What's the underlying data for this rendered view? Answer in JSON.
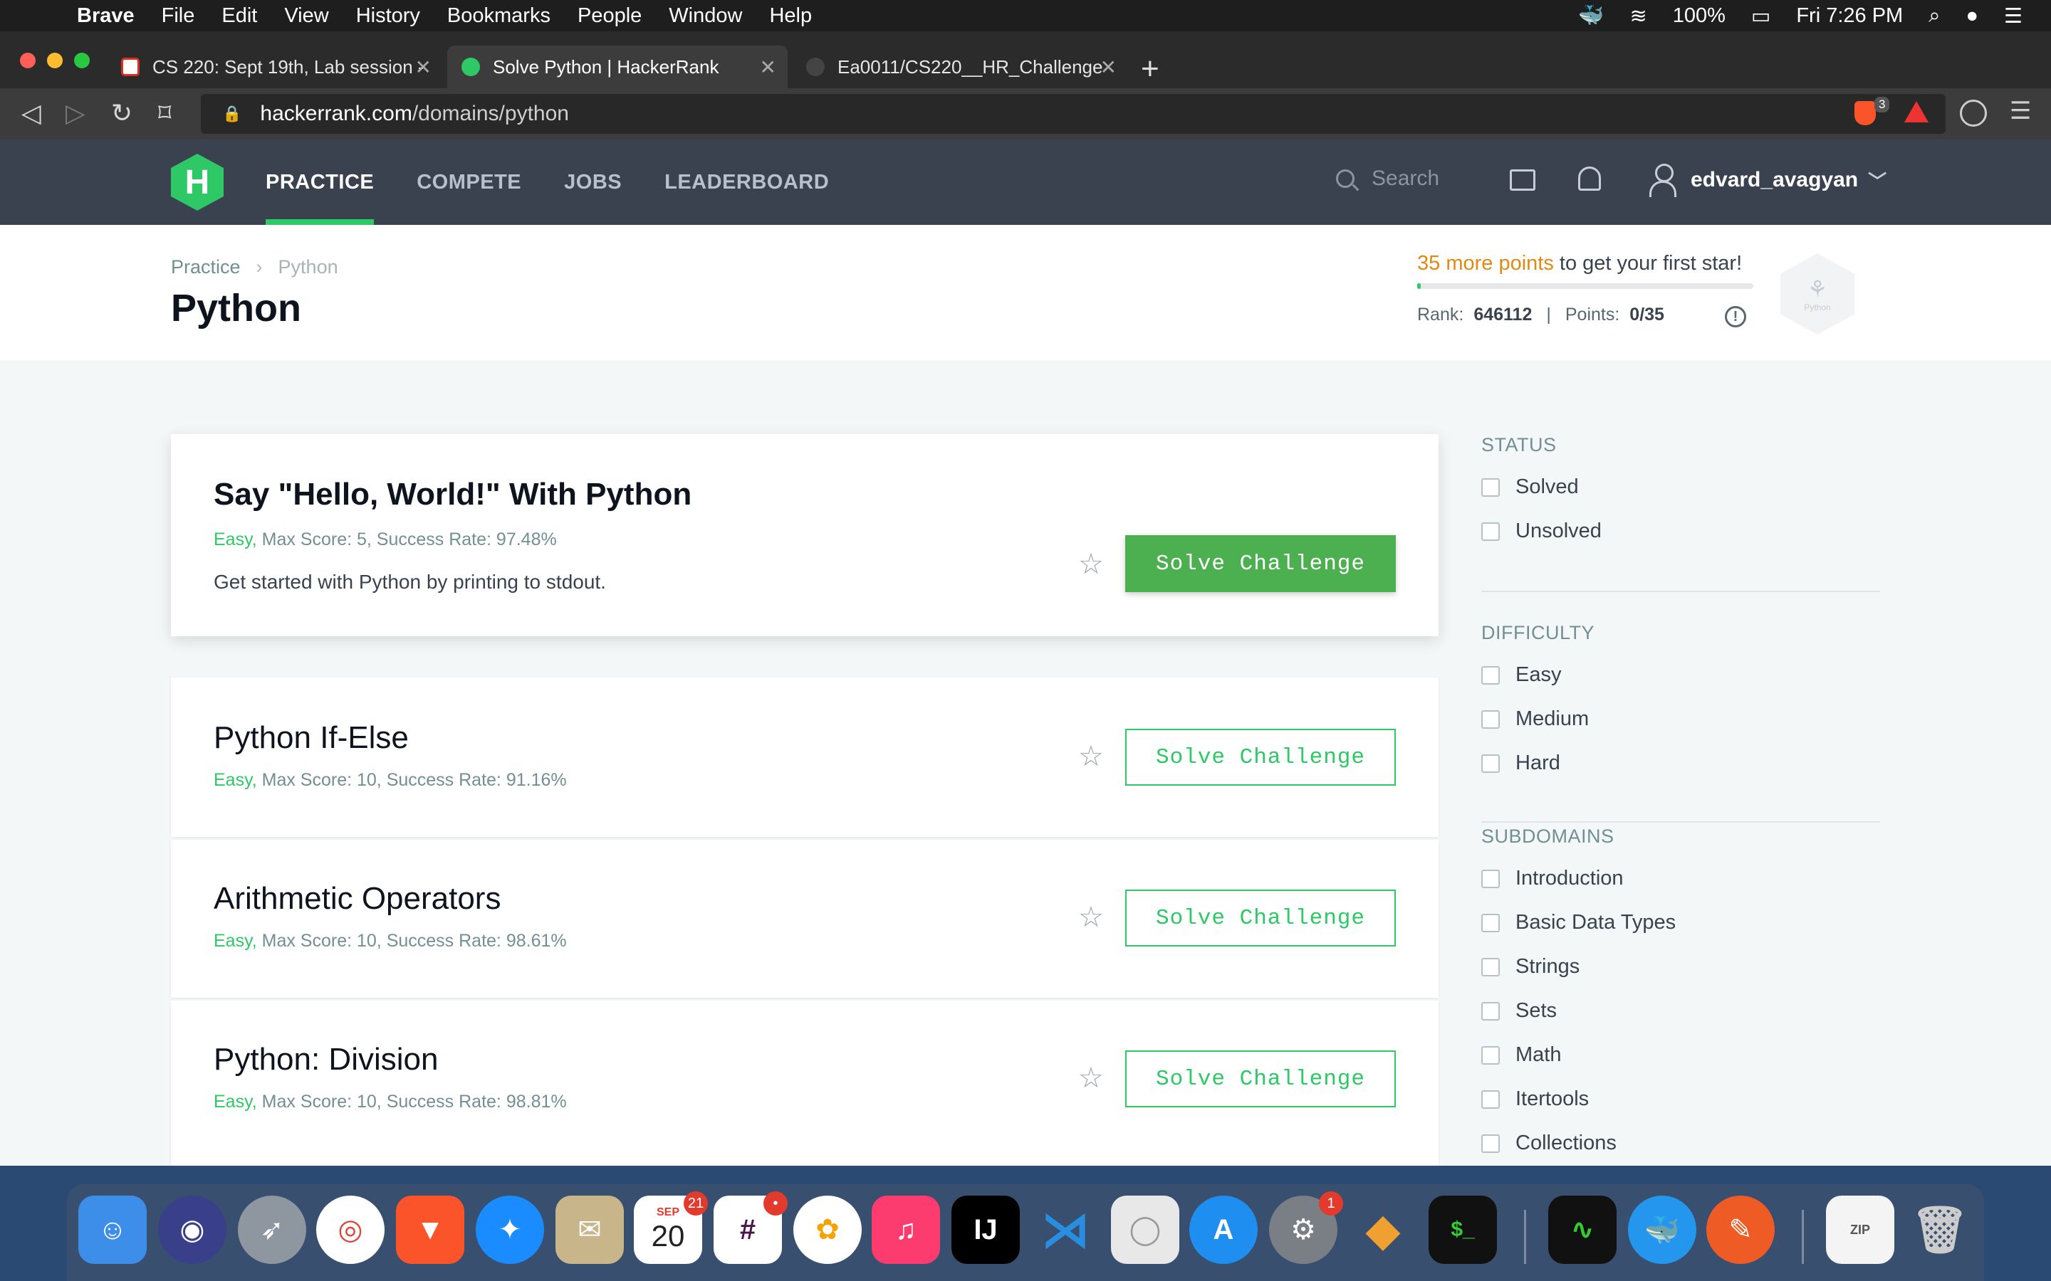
{
  "menubar": {
    "app": "Brave",
    "items": [
      "File",
      "Edit",
      "View",
      "History",
      "Bookmarks",
      "People",
      "Window",
      "Help"
    ],
    "battery": "100%",
    "clock": "Fri 7:26 PM"
  },
  "tabs": [
    {
      "title": "CS 220: Sept 19th, Lab session -",
      "icon": "gmail-icon"
    },
    {
      "title": "Solve Python | HackerRank",
      "icon": "hackerrank-icon"
    },
    {
      "title": "Ea0011/CS220__HR_Challenge",
      "icon": "github-icon"
    }
  ],
  "address": {
    "host": "hackerrank.com",
    "path": "/domains/python",
    "brave_count": "3"
  },
  "hr": {
    "logo": "H",
    "nav": [
      "PRACTICE",
      "COMPETE",
      "JOBS",
      "LEADERBOARD"
    ],
    "search_placeholder": "Search",
    "username": "edvard_avagyan"
  },
  "page": {
    "breadcrumb": [
      "Practice",
      "Python"
    ],
    "title": "Python",
    "points_highlight": "35 more points",
    "points_rest": " to get your first star!",
    "progress_fraction": 0.0,
    "rank_label": "Rank:",
    "rank_value": "646112",
    "points_label": "Points:",
    "points_value": "0/35",
    "badge_label": "Python"
  },
  "challenges": [
    {
      "title": "Say \"Hello, World!\" With Python",
      "difficulty": "Easy,",
      "meta": " Max Score: 5, Success Rate: 97.48%",
      "description": "Get started with Python by printing to stdout.",
      "button": "Solve Challenge"
    },
    {
      "title": "Python If-Else",
      "difficulty": "Easy,",
      "meta": " Max Score: 10, Success Rate: 91.16%",
      "button": "Solve Challenge"
    },
    {
      "title": "Arithmetic Operators",
      "difficulty": "Easy,",
      "meta": " Max Score: 10, Success Rate: 98.61%",
      "button": "Solve Challenge"
    },
    {
      "title": "Python: Division",
      "difficulty": "Easy,",
      "meta": " Max Score: 10, Success Rate: 98.81%",
      "button": "Solve Challenge"
    }
  ],
  "filters": {
    "status_title": "STATUS",
    "status": [
      "Solved",
      "Unsolved"
    ],
    "difficulty_title": "DIFFICULTY",
    "difficulty": [
      "Easy",
      "Medium",
      "Hard"
    ],
    "subdomains_title": "SUBDOMAINS",
    "subdomains": [
      "Introduction",
      "Basic Data Types",
      "Strings",
      "Sets",
      "Math",
      "Itertools",
      "Collections"
    ]
  },
  "dock": {
    "calendar_month": "SEP",
    "calendar_day": "20",
    "calendar_badge": "21",
    "prefs_badge": "1"
  }
}
